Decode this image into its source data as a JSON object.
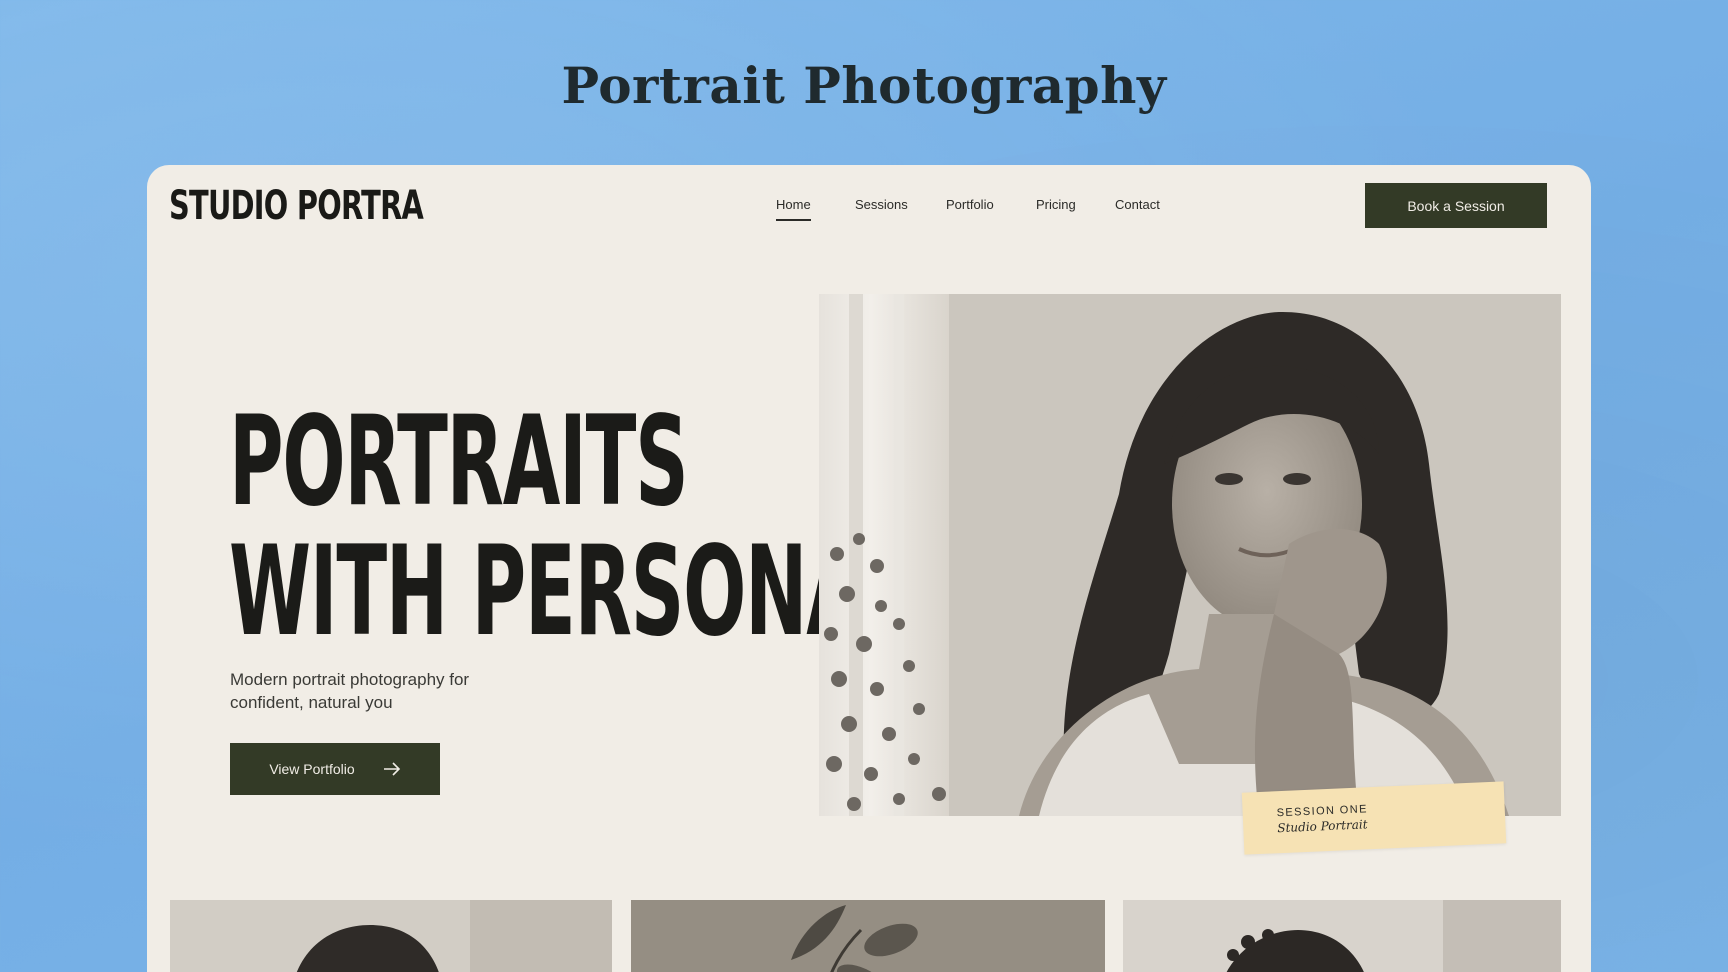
{
  "page": {
    "heading": "Portrait Photography"
  },
  "site": {
    "logo": "STUDIO PORTRA",
    "nav": [
      {
        "label": "Home",
        "active": true
      },
      {
        "label": "Sessions",
        "active": false
      },
      {
        "label": "Portfolio",
        "active": false
      },
      {
        "label": "Pricing",
        "active": false
      },
      {
        "label": "Contact",
        "active": false
      }
    ],
    "book_button": "Book a Session"
  },
  "hero": {
    "title_line1": "PORTRAITS",
    "title_line2": "WITH PERSONALITY",
    "subtitle": "Modern portrait photography for confident, natural you",
    "cta_label": "View Portfolio",
    "cta_icon": "arrow-right-icon",
    "photo": "hero-portrait-photo",
    "caption": {
      "label": "SESSION ONE",
      "sub": "Studio Portrait"
    }
  },
  "gallery": {
    "tiles": [
      "portrait-woman-photo",
      "plant-still-life-photo",
      "portrait-person-curly-hair-photo"
    ]
  },
  "colors": {
    "background": "#7bb4e8",
    "card": "#f1ede6",
    "accent": "#333a26",
    "tag": "#f6e2b4",
    "text": "#1b1b18"
  }
}
